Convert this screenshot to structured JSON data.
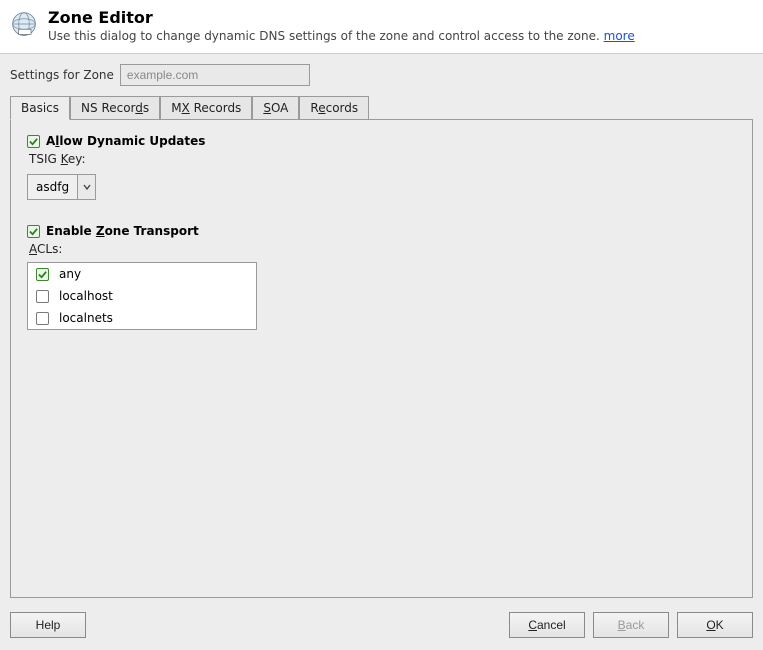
{
  "header": {
    "title": "Zone Editor",
    "subtitle": "Use this dialog to change dynamic DNS settings of the zone and control access to the zone. ",
    "more_label": "more"
  },
  "zone_row": {
    "label": "Settings for Zone",
    "value": "example.com"
  },
  "tabs": [
    {
      "label": "Basics"
    },
    {
      "pre": "NS Recor",
      "ul": "d",
      "post": "s"
    },
    {
      "pre": "M",
      "ul": "X",
      "post": " Records"
    },
    {
      "ul": "S",
      "post": "OA"
    },
    {
      "pre": "R",
      "ul": "e",
      "post": "cords"
    }
  ],
  "basics": {
    "dyn_updates": {
      "pre": "A",
      "ul": "l",
      "post": "low Dynamic Updates"
    },
    "tsig_label": {
      "pre": "TSIG ",
      "ul": "K",
      "post": "ey:"
    },
    "tsig_value": "asdfg",
    "zone_transport": {
      "pre": "Enable ",
      "ul": "Z",
      "post": "one Transport"
    },
    "acls_label": {
      "ul": "A",
      "post": "CLs:"
    },
    "acls": [
      {
        "label": "any",
        "checked": true
      },
      {
        "label": "localhost",
        "checked": false
      },
      {
        "label": "localnets",
        "checked": false
      }
    ]
  },
  "footer": {
    "help": "Help",
    "cancel": {
      "ul": "C",
      "post": "ancel"
    },
    "back": {
      "ul": "B",
      "post": "ack"
    },
    "ok": {
      "ul": "O",
      "post": "K"
    }
  }
}
